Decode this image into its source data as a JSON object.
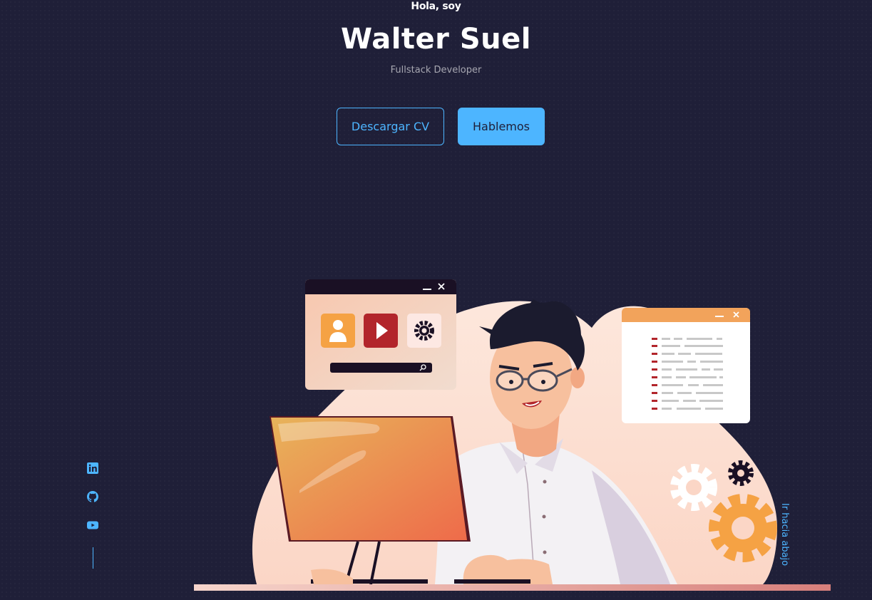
{
  "header": {
    "greeting": "Hola, soy",
    "name": "Walter Suel",
    "role": "Fullstack Developer"
  },
  "cta": {
    "download_label": "Descargar CV",
    "talk_label": "Hablemos"
  },
  "socials": [
    {
      "icon": "linkedin-icon"
    },
    {
      "icon": "github-icon"
    },
    {
      "icon": "youtube-icon"
    }
  ],
  "scroll": {
    "label": "Ir hacia abajo"
  },
  "colors": {
    "background": "#1f1f38",
    "accent": "#4db5ff",
    "text": "#ffffff"
  }
}
